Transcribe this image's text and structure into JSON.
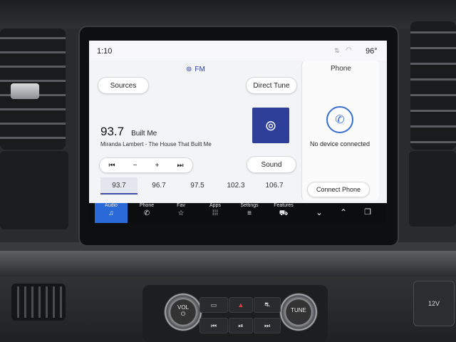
{
  "status_bar": {
    "time": "1:10",
    "temperature": "96°"
  },
  "source": {
    "icon": "radio-antenna-icon",
    "band": "FM"
  },
  "buttons": {
    "sources": "Sources",
    "direct_tune": "Direct Tune",
    "sound": "Sound"
  },
  "station": {
    "frequency": "93.7",
    "name": "Built Me",
    "song": "Miranda Lambert - The House That Built Me"
  },
  "transport": {
    "seek_back": "⏮",
    "minus": "−",
    "plus": "+",
    "seek_forward": "⏭"
  },
  "presets": [
    "93.7",
    "96.7",
    "97.5",
    "102.3",
    "106.7"
  ],
  "phone_panel": {
    "title": "Phone",
    "status": "No device connected",
    "connect_button": "Connect Phone"
  },
  "nav_bar": [
    {
      "label": "Audio",
      "icon": "♫",
      "active": true
    },
    {
      "label": "Phone",
      "icon": "✆",
      "active": false
    },
    {
      "label": "Fav",
      "icon": "☆",
      "active": false
    },
    {
      "label": "Apps",
      "icon": "⁞⁞⁞",
      "active": false
    },
    {
      "label": "Settings",
      "icon": "≡",
      "active": false
    },
    {
      "label": "Features",
      "icon": "⛟",
      "active": false
    }
  ],
  "nav_icons": {
    "collapse": "⌄",
    "expand": "⌃",
    "screen": "❐"
  },
  "console": {
    "vol_label": "VOL",
    "vol_sub": "⏻",
    "tune_label": "TUNE",
    "hazard": "▲",
    "prev": "⏮",
    "play_pause": "⏯",
    "next": "⏭",
    "outlet_label": "12V"
  },
  "accent_color": "#2a6ad8",
  "station_tile_color": "#2e3f99"
}
